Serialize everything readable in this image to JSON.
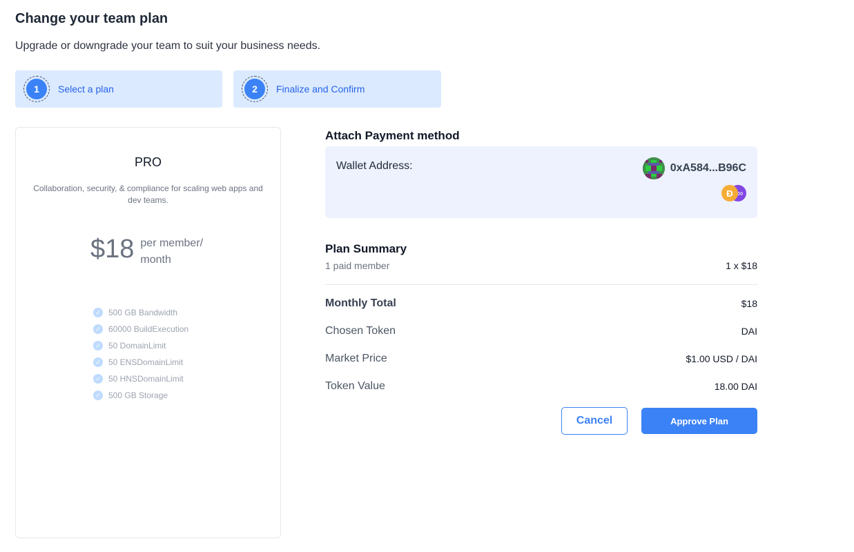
{
  "header": {
    "title": "Change your team plan",
    "subtitle": "Upgrade or downgrade your team to suit your business needs."
  },
  "steps": [
    {
      "number": "1",
      "label": "Select a plan"
    },
    {
      "number": "2",
      "label": "Finalize and Confirm"
    }
  ],
  "plan": {
    "name": "PRO",
    "description": "Collaboration, security, & compliance for scaling web apps and dev teams.",
    "price": "$18",
    "price_unit": "per member/ month",
    "features": [
      "500 GB Bandwidth",
      "60000 BuildExecution",
      "50 DomainLimit",
      "50 ENSDomainLimit",
      "50 HNSDomainLimit",
      "500 GB Storage"
    ]
  },
  "payment": {
    "title": "Attach Payment method",
    "wallet_label": "Wallet Address:",
    "wallet_address": "0xA584...B96C",
    "token_icons": [
      "dai-token-icon",
      "polygon-matic-icon"
    ]
  },
  "summary": {
    "title": "Plan Summary",
    "paid_members_label": "1 paid member",
    "paid_members_value": "1 x $18",
    "monthly_total_label": "Monthly Total",
    "monthly_total_value": "$18",
    "chosen_token_label": "Chosen Token",
    "chosen_token_value": "DAI",
    "market_price_label": "Market Price",
    "market_price_value": "$1.00 USD / DAI",
    "token_value_label": "Token Value",
    "token_value_value": "18.00 DAI"
  },
  "actions": {
    "cancel_label": "Cancel",
    "approve_label": "Approve Plan"
  },
  "colors": {
    "accent": "#3b82f6",
    "step_bg": "#dbeafe",
    "wallet_bg": "#eef2ff"
  }
}
